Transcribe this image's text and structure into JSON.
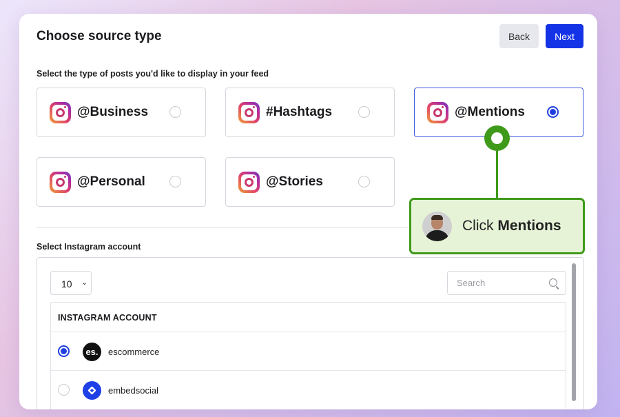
{
  "header": {
    "title": "Choose source type",
    "back_label": "Back",
    "next_label": "Next"
  },
  "source_section": {
    "heading": "Select the type of posts you'd like to display in your feed",
    "options": [
      {
        "label": "@Business",
        "icon": "instagram-icon",
        "selected": false
      },
      {
        "label": "#Hashtags",
        "icon": "instagram-icon",
        "selected": false
      },
      {
        "label": "@Mentions",
        "icon": "instagram-icon",
        "selected": true
      },
      {
        "label": "@Personal",
        "icon": "instagram-icon",
        "selected": false
      },
      {
        "label": "@Stories",
        "icon": "instagram-icon",
        "selected": false
      }
    ]
  },
  "account_section": {
    "heading": "Select Instagram account",
    "page_size": "10",
    "search_placeholder": "Search",
    "column_header": "INSTAGRAM ACCOUNT",
    "rows": [
      {
        "name": "escommerce",
        "avatar_text": "es.",
        "avatar_color": "#111111",
        "selected": true
      },
      {
        "name": "embedsocial",
        "avatar_text": "",
        "avatar_color": "#1e40e6",
        "selected": false
      }
    ]
  },
  "callout": {
    "prefix": "Click",
    "emphasis": "Mentions",
    "accent_color": "#3f9a1a"
  },
  "colors": {
    "primary": "#1533e6",
    "selected_radio": "#1e3fe0",
    "callout_bg": "#e6f3d7"
  }
}
